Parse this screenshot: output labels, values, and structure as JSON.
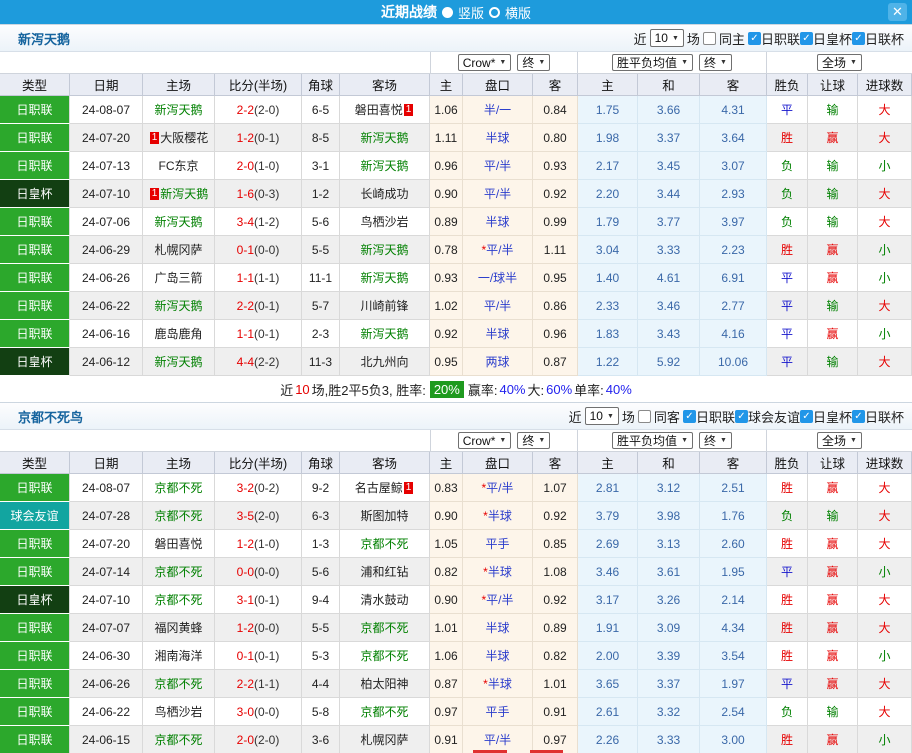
{
  "colors": {
    "titlebar_blue": "#1e9bdc",
    "close_blue": "#4fb3e8",
    "checkbox_blue": "#2196e8",
    "league_green": "#2ca82c",
    "cup_dark_green": "#123f12",
    "friendly_teal": "#12a5a0",
    "team_green": "#008000",
    "score_red": "#e60000",
    "handicap_blue": "#2b3dcc",
    "avg_blue": "#3a68a8",
    "summary_badge_green": "#1f9a1f",
    "summary_value_blue": "#2222ee",
    "odds_cream_bg": "#fdf5ea",
    "avg_bg": "#eaf5fc",
    "team_name_blue": "#16649e"
  },
  "titlebar": {
    "title": "近期战绩",
    "vertical_label": "竖版",
    "horizontal_label": "横版",
    "vertical_selected": true,
    "close_glyph": "✕"
  },
  "sections": [
    {
      "team": "新泻天鹅",
      "controls": {
        "near": "近",
        "count": "10",
        "games": "场",
        "same": "同主",
        "same_checked": false,
        "leagues": [
          {
            "label": "日职联",
            "checked": true
          },
          {
            "label": "日皇杯",
            "checked": true
          },
          {
            "label": "日联杯",
            "checked": true
          }
        ]
      },
      "odds_headers": {
        "bookmaker": "Crow*",
        "final1": "终",
        "avg": "胜平负均值",
        "final2": "终",
        "scope": "全场"
      },
      "columns": [
        "类型",
        "日期",
        "主场",
        "比分(半场)",
        "角球",
        "客场",
        "主",
        "盘口",
        "客",
        "主",
        "和",
        "客",
        "胜负",
        "让球",
        "进球数"
      ],
      "rows": [
        {
          "type": "日职联",
          "date": "24-08-07",
          "home": {
            "n": "新泻天鹅",
            "self": true
          },
          "score": "2-2",
          "half": "(2-0)",
          "corner": "6-5",
          "away": {
            "n": "磐田喜悦",
            "badge": "1",
            "side": "r"
          },
          "ho": "1.06",
          "hcap": "半/一",
          "star": false,
          "ao": "0.84",
          "ah": "1.75",
          "ad": "3.66",
          "aa": "4.31",
          "res": "平",
          "lr": "输",
          "gl": "大"
        },
        {
          "type": "日职联",
          "date": "24-07-20",
          "home": {
            "n": "大阪樱花",
            "badge": "1",
            "side": "l"
          },
          "score": "1-2",
          "half": "(0-1)",
          "corner": "8-5",
          "away": {
            "n": "新泻天鹅",
            "self": true
          },
          "ho": "1.11",
          "hcap": "半球",
          "star": false,
          "ao": "0.80",
          "ah": "1.98",
          "ad": "3.37",
          "aa": "3.64",
          "res": "胜",
          "lr": "赢",
          "gl": "大"
        },
        {
          "type": "日职联",
          "date": "24-07-13",
          "home": {
            "n": "FC东京"
          },
          "score": "2-0",
          "half": "(1-0)",
          "corner": "3-1",
          "away": {
            "n": "新泻天鹅",
            "self": true
          },
          "ho": "0.96",
          "hcap": "平/半",
          "star": false,
          "ao": "0.93",
          "ah": "2.17",
          "ad": "3.45",
          "aa": "3.07",
          "res": "负",
          "lr": "输",
          "gl": "小"
        },
        {
          "type": "日皇杯",
          "date": "24-07-10",
          "home": {
            "n": "新泻天鹅",
            "self": true,
            "badge": "1",
            "side": "l"
          },
          "score": "1-6",
          "half": "(0-3)",
          "corner": "1-2",
          "away": {
            "n": "长崎成功"
          },
          "ho": "0.90",
          "hcap": "平/半",
          "star": false,
          "ao": "0.92",
          "ah": "2.20",
          "ad": "3.44",
          "aa": "2.93",
          "res": "负",
          "lr": "输",
          "gl": "大"
        },
        {
          "type": "日职联",
          "date": "24-07-06",
          "home": {
            "n": "新泻天鹅",
            "self": true
          },
          "score": "3-4",
          "half": "(1-2)",
          "corner": "5-6",
          "away": {
            "n": "鸟栖沙岩"
          },
          "ho": "0.89",
          "hcap": "半球",
          "star": false,
          "ao": "0.99",
          "ah": "1.79",
          "ad": "3.77",
          "aa": "3.97",
          "res": "负",
          "lr": "输",
          "gl": "大"
        },
        {
          "type": "日职联",
          "date": "24-06-29",
          "home": {
            "n": "札幌冈萨"
          },
          "score": "0-1",
          "half": "(0-0)",
          "corner": "5-5",
          "away": {
            "n": "新泻天鹅",
            "self": true
          },
          "ho": "0.78",
          "hcap": "平/半",
          "star": true,
          "ao": "1.11",
          "ah": "3.04",
          "ad": "3.33",
          "aa": "2.23",
          "res": "胜",
          "lr": "赢",
          "gl": "小"
        },
        {
          "type": "日职联",
          "date": "24-06-26",
          "home": {
            "n": "广岛三箭"
          },
          "score": "1-1",
          "half": "(1-1)",
          "corner": "11-1",
          "away": {
            "n": "新泻天鹅",
            "self": true
          },
          "ho": "0.93",
          "hcap": "一/球半",
          "star": false,
          "ao": "0.95",
          "ah": "1.40",
          "ad": "4.61",
          "aa": "6.91",
          "res": "平",
          "lr": "赢",
          "gl": "小"
        },
        {
          "type": "日职联",
          "date": "24-06-22",
          "home": {
            "n": "新泻天鹅",
            "self": true
          },
          "score": "2-2",
          "half": "(0-1)",
          "corner": "5-7",
          "away": {
            "n": "川崎前锋"
          },
          "ho": "1.02",
          "hcap": "平/半",
          "star": false,
          "ao": "0.86",
          "ah": "2.33",
          "ad": "3.46",
          "aa": "2.77",
          "res": "平",
          "lr": "输",
          "gl": "大"
        },
        {
          "type": "日职联",
          "date": "24-06-16",
          "home": {
            "n": "鹿岛鹿角"
          },
          "score": "1-1",
          "half": "(0-1)",
          "corner": "2-3",
          "away": {
            "n": "新泻天鹅",
            "self": true
          },
          "ho": "0.92",
          "hcap": "半球",
          "star": false,
          "ao": "0.96",
          "ah": "1.83",
          "ad": "3.43",
          "aa": "4.16",
          "res": "平",
          "lr": "赢",
          "gl": "小"
        },
        {
          "type": "日皇杯",
          "date": "24-06-12",
          "home": {
            "n": "新泻天鹅",
            "self": true
          },
          "score": "4-4",
          "half": "(2-2)",
          "corner": "11-3",
          "away": {
            "n": "北九州向"
          },
          "ho": "0.95",
          "hcap": "两球",
          "star": false,
          "ao": "0.87",
          "ah": "1.22",
          "ad": "5.92",
          "aa": "10.06",
          "res": "平",
          "lr": "输",
          "gl": "大"
        }
      ],
      "summary": [
        {
          "t": "近",
          "c": "k"
        },
        {
          "t": "10",
          "c": "r"
        },
        {
          "t": "场,胜2平5负3, 胜率:",
          "c": "k"
        },
        {
          "t": "20%",
          "c": "badge"
        },
        {
          "t": "赢率:",
          "c": "k"
        },
        {
          "t": "40%",
          "c": "b"
        },
        {
          "t": " 大:",
          "c": "k"
        },
        {
          "t": "60%",
          "c": "b"
        },
        {
          "t": " 单率:",
          "c": "k"
        },
        {
          "t": "40%",
          "c": "b"
        }
      ]
    },
    {
      "team": "京都不死鸟",
      "controls": {
        "near": "近",
        "count": "10",
        "games": "场",
        "same": "同客",
        "same_checked": false,
        "leagues": [
          {
            "label": "日职联",
            "checked": true
          },
          {
            "label": "球会友谊",
            "checked": true
          },
          {
            "label": "日皇杯",
            "checked": true
          },
          {
            "label": "日联杯",
            "checked": true
          }
        ]
      },
      "odds_headers": {
        "bookmaker": "Crow*",
        "final1": "终",
        "avg": "胜平负均值",
        "final2": "终",
        "scope": "全场"
      },
      "columns": [
        "类型",
        "日期",
        "主场",
        "比分(半场)",
        "角球",
        "客场",
        "主",
        "盘口",
        "客",
        "主",
        "和",
        "客",
        "胜负",
        "让球",
        "进球数"
      ],
      "rows": [
        {
          "type": "日职联",
          "date": "24-08-07",
          "home": {
            "n": "京都不死",
            "self": true
          },
          "score": "3-2",
          "half": "(0-2)",
          "corner": "9-2",
          "away": {
            "n": "名古屋鲸",
            "badge": "1",
            "side": "r"
          },
          "ho": "0.83",
          "hcap": "平/半",
          "star": true,
          "ao": "1.07",
          "ah": "2.81",
          "ad": "3.12",
          "aa": "2.51",
          "res": "胜",
          "lr": "赢",
          "gl": "大"
        },
        {
          "type": "球会友谊",
          "date": "24-07-28",
          "home": {
            "n": "京都不死",
            "self": true
          },
          "score": "3-5",
          "half": "(2-0)",
          "corner": "6-3",
          "away": {
            "n": "斯图加特"
          },
          "ho": "0.90",
          "hcap": "半球",
          "star": true,
          "ao": "0.92",
          "ah": "3.79",
          "ad": "3.98",
          "aa": "1.76",
          "res": "负",
          "lr": "输",
          "gl": "大"
        },
        {
          "type": "日职联",
          "date": "24-07-20",
          "home": {
            "n": "磐田喜悦"
          },
          "score": "1-2",
          "half": "(1-0)",
          "corner": "1-3",
          "away": {
            "n": "京都不死",
            "self": true
          },
          "ho": "1.05",
          "hcap": "平手",
          "star": false,
          "ao": "0.85",
          "ah": "2.69",
          "ad": "3.13",
          "aa": "2.60",
          "res": "胜",
          "lr": "赢",
          "gl": "大"
        },
        {
          "type": "日职联",
          "date": "24-07-14",
          "home": {
            "n": "京都不死",
            "self": true
          },
          "score": "0-0",
          "half": "(0-0)",
          "corner": "5-6",
          "away": {
            "n": "浦和红钻"
          },
          "ho": "0.82",
          "hcap": "半球",
          "star": true,
          "ao": "1.08",
          "ah": "3.46",
          "ad": "3.61",
          "aa": "1.95",
          "res": "平",
          "lr": "赢",
          "gl": "小"
        },
        {
          "type": "日皇杯",
          "date": "24-07-10",
          "home": {
            "n": "京都不死",
            "self": true
          },
          "score": "3-1",
          "half": "(0-1)",
          "corner": "9-4",
          "away": {
            "n": "清水鼓动"
          },
          "ho": "0.90",
          "hcap": "平/半",
          "star": true,
          "ao": "0.92",
          "ah": "3.17",
          "ad": "3.26",
          "aa": "2.14",
          "res": "胜",
          "lr": "赢",
          "gl": "大"
        },
        {
          "type": "日职联",
          "date": "24-07-07",
          "home": {
            "n": "福冈黄蜂"
          },
          "score": "1-2",
          "half": "(0-0)",
          "corner": "5-5",
          "away": {
            "n": "京都不死",
            "self": true
          },
          "ho": "1.01",
          "hcap": "半球",
          "star": false,
          "ao": "0.89",
          "ah": "1.91",
          "ad": "3.09",
          "aa": "4.34",
          "res": "胜",
          "lr": "赢",
          "gl": "大"
        },
        {
          "type": "日职联",
          "date": "24-06-30",
          "home": {
            "n": "湘南海洋"
          },
          "score": "0-1",
          "half": "(0-1)",
          "corner": "5-3",
          "away": {
            "n": "京都不死",
            "self": true
          },
          "ho": "1.06",
          "hcap": "半球",
          "star": false,
          "ao": "0.82",
          "ah": "2.00",
          "ad": "3.39",
          "aa": "3.54",
          "res": "胜",
          "lr": "赢",
          "gl": "小"
        },
        {
          "type": "日职联",
          "date": "24-06-26",
          "home": {
            "n": "京都不死",
            "self": true
          },
          "score": "2-2",
          "half": "(1-1)",
          "corner": "4-4",
          "away": {
            "n": "柏太阳神"
          },
          "ho": "0.87",
          "hcap": "半球",
          "star": true,
          "ao": "1.01",
          "ah": "3.65",
          "ad": "3.37",
          "aa": "1.97",
          "res": "平",
          "lr": "赢",
          "gl": "大"
        },
        {
          "type": "日职联",
          "date": "24-06-22",
          "home": {
            "n": "鸟栖沙岩"
          },
          "score": "3-0",
          "half": "(0-0)",
          "corner": "5-8",
          "away": {
            "n": "京都不死",
            "self": true
          },
          "ho": "0.97",
          "hcap": "平手",
          "star": false,
          "ao": "0.91",
          "ah": "2.61",
          "ad": "3.32",
          "aa": "2.54",
          "res": "负",
          "lr": "输",
          "gl": "大"
        },
        {
          "type": "日职联",
          "date": "24-06-15",
          "home": {
            "n": "京都不死",
            "self": true
          },
          "score": "2-0",
          "half": "(2-0)",
          "corner": "3-6",
          "away": {
            "n": "札幌冈萨"
          },
          "ho": "0.91",
          "hcap": "平/半",
          "star": false,
          "ao": "0.97",
          "ah": "2.26",
          "ad": "3.33",
          "aa": "3.00",
          "res": "胜",
          "lr": "赢",
          "gl": "小"
        }
      ],
      "summary": null
    }
  ]
}
